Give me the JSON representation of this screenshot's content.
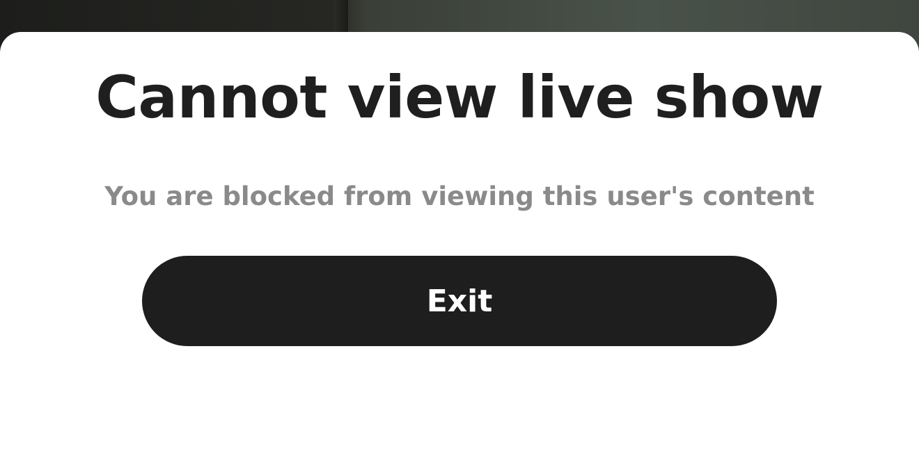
{
  "dialog": {
    "title": "Cannot view live show",
    "message": "You are blocked from viewing this user's content",
    "exit_label": "Exit"
  },
  "colors": {
    "sheet_background": "#ffffff",
    "title_text": "#1f1f1f",
    "message_text": "#8a8a8a",
    "button_background": "#1e1e1e",
    "button_text": "#ffffff"
  }
}
